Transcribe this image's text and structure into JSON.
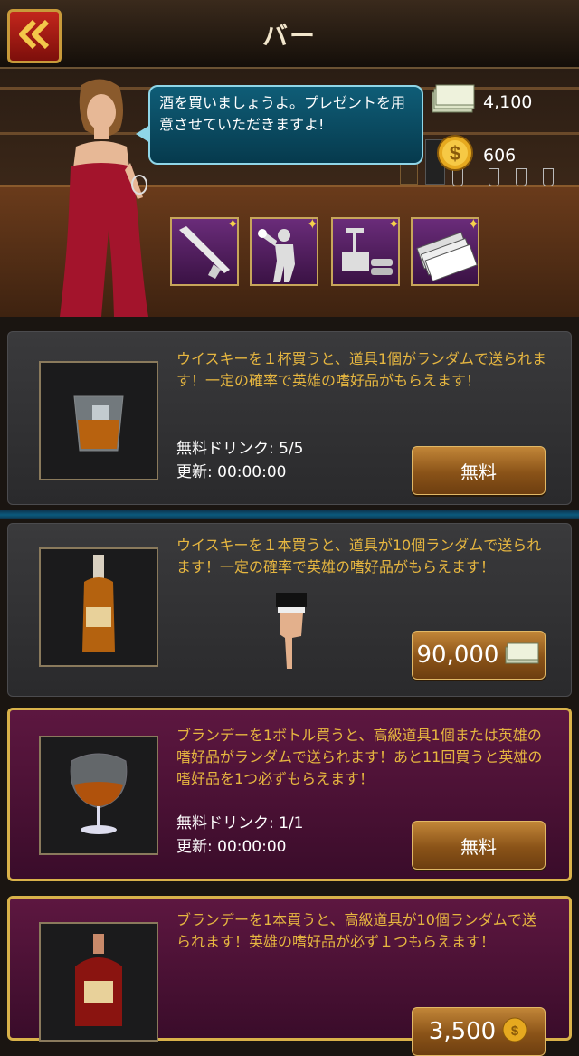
{
  "header": {
    "title": "バー",
    "back_icon": "double-chevron-left-icon"
  },
  "bartender": {
    "speech": "酒を買いましょうよ。プレゼントを用意させていただきますよ!"
  },
  "resources": {
    "cash": "4,100",
    "gold": "606"
  },
  "reward_items": [
    {
      "name": "shotgun"
    },
    {
      "name": "boxer"
    },
    {
      "name": "detonator"
    },
    {
      "name": "cash-stack"
    }
  ],
  "offers": [
    {
      "desc": "ウイスキーを１杯買うと、道具1個がランダムで送られます！一定の確率で英雄の嗜好品がもらえます！",
      "free_label": "無料ドリンク: 5/5",
      "refresh_label": "更新: 00:00:00",
      "button": "無料"
    },
    {
      "desc": "ウイスキーを１本買うと、道具が10個ランダムで送られます！一定の確率で英雄の嗜好品がもらえます！",
      "button": "90,000"
    },
    {
      "desc": "ブランデーを1ボトル買うと、高級道具1個または英雄の嗜好品がランダムで送られます！あと11回買うと英雄の嗜好品を1つ必ずもらえます！",
      "free_label": "無料ドリンク: 1/1",
      "refresh_label": "更新: 00:00:00",
      "button": "無料"
    },
    {
      "desc": "ブランデーを1本買うと、高級道具が10個ランダムで送られます！英雄の嗜好品が必ず１つもらえます！",
      "button": "3,500"
    }
  ]
}
